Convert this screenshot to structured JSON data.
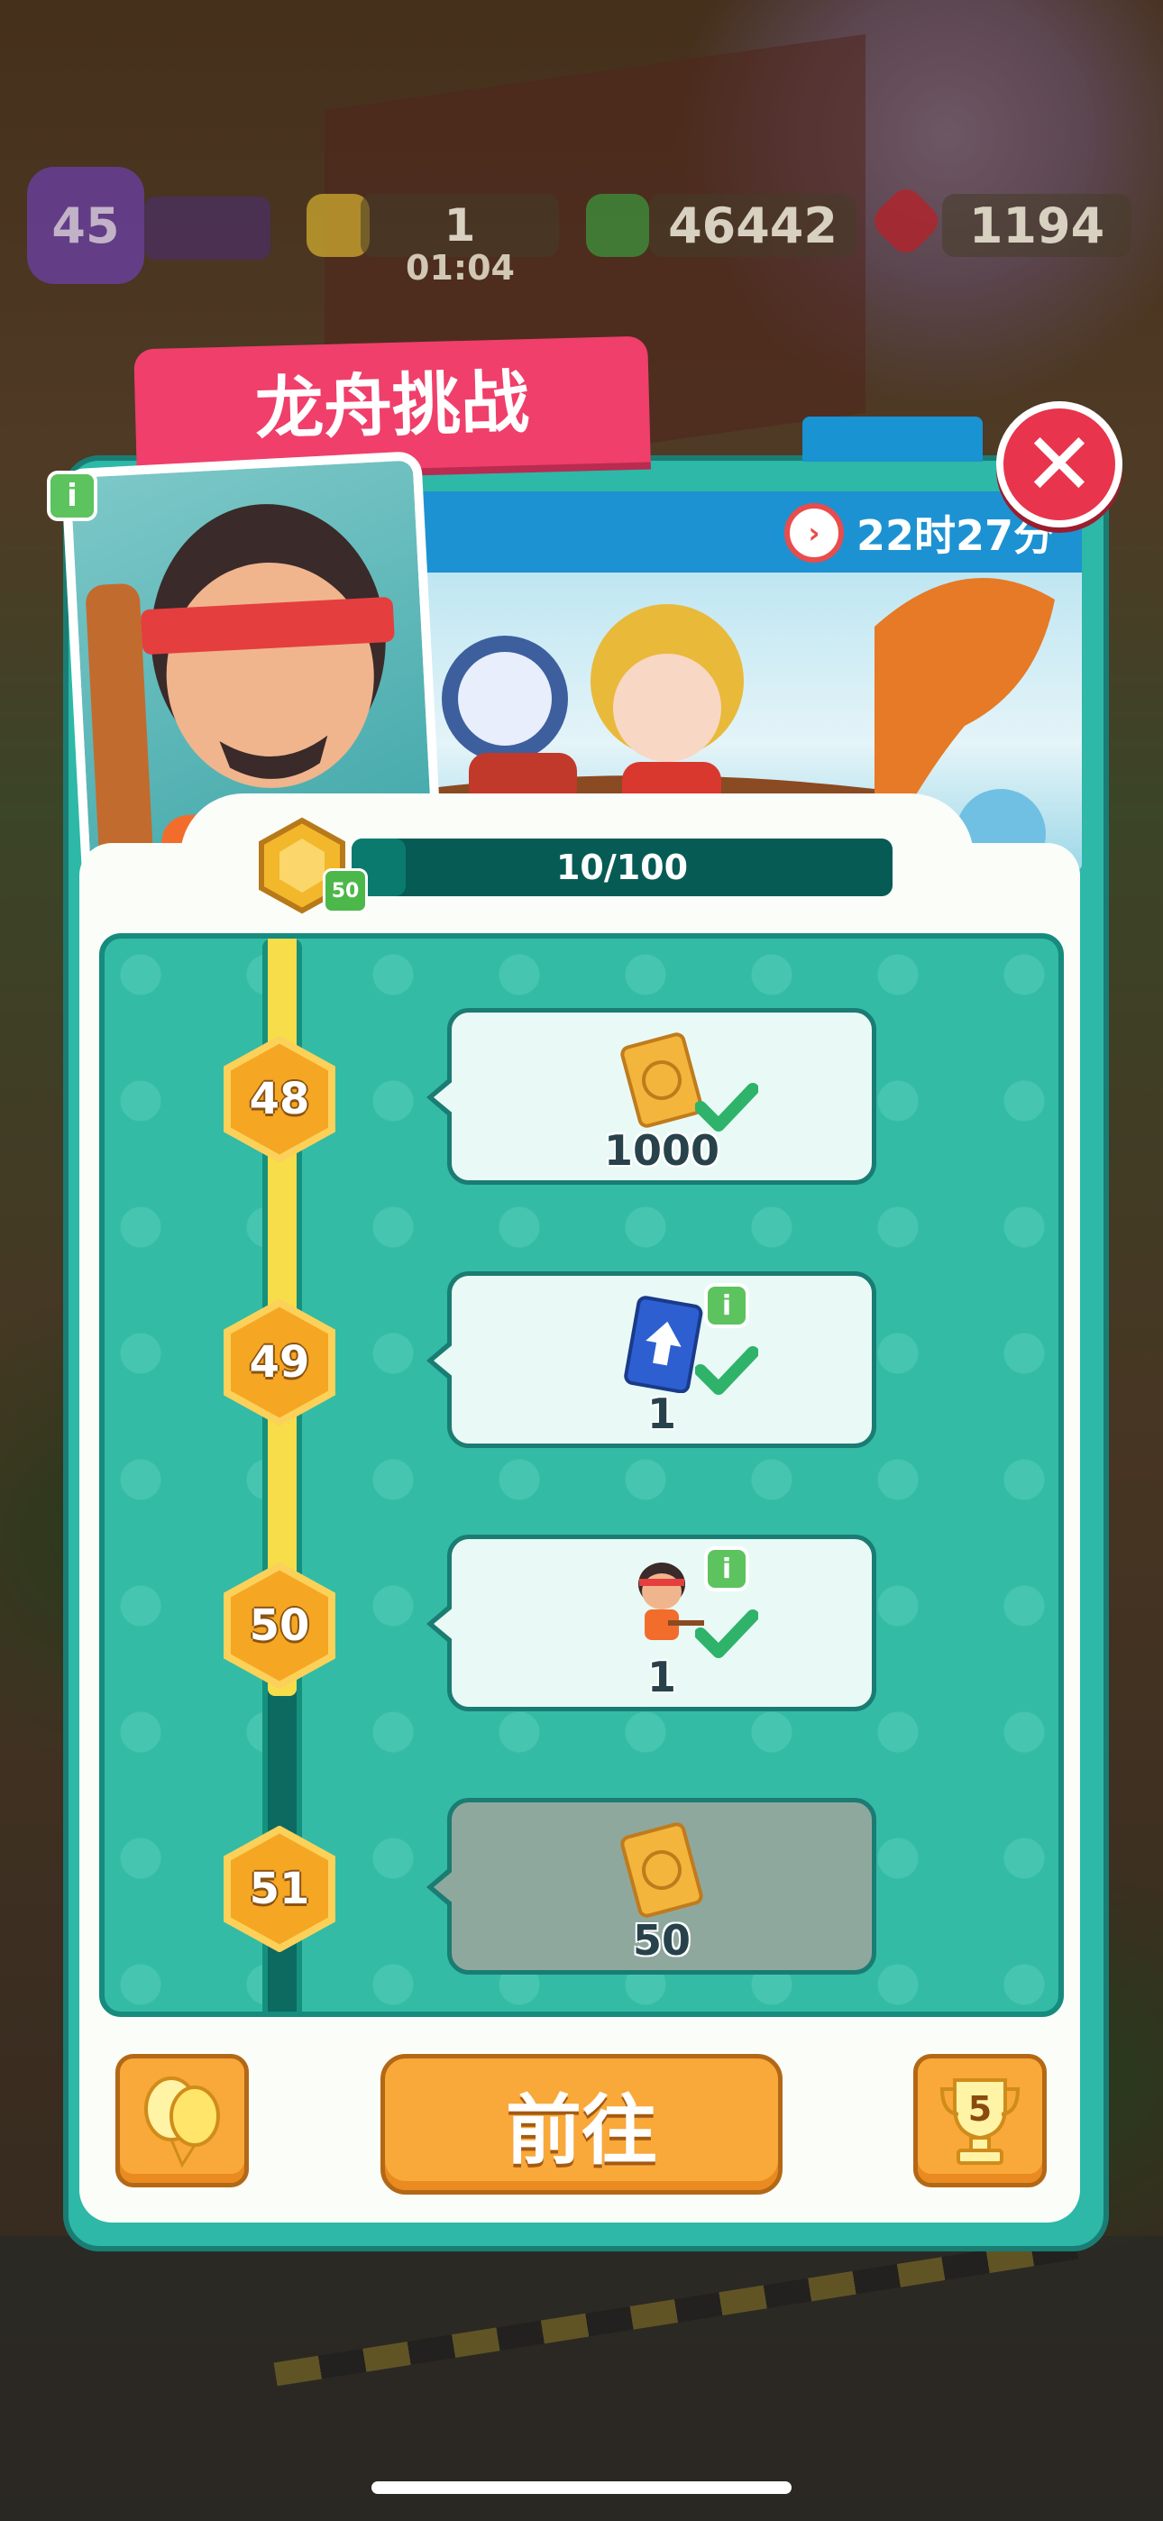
{
  "hud": {
    "player_level": "45",
    "energy": "1",
    "energy_timer": "01:04",
    "cash": "46442",
    "gems": "1194"
  },
  "event": {
    "title": "龙舟挑战",
    "timer": "22时27分",
    "token_badge": "50",
    "progress_text": "10/100",
    "progress_fraction": 0.1
  },
  "milestones": [
    {
      "level": "48",
      "reward_amount": "1000",
      "reward_icon": "ticket-icon",
      "claimed": true
    },
    {
      "level": "49",
      "reward_amount": "1",
      "reward_icon": "upgrade-card-icon",
      "claimed": true
    },
    {
      "level": "50",
      "reward_amount": "1",
      "reward_icon": "character-icon",
      "claimed": true
    },
    {
      "level": "51",
      "reward_amount": "50",
      "reward_icon": "ticket-icon",
      "claimed": false
    }
  ],
  "buttons": {
    "go_label": "前往",
    "trophy_rank": "5"
  },
  "colors": {
    "accent_pink": "#ef3f6a",
    "panel_teal": "#2db8a8",
    "button_orange": "#f9a83a",
    "close_red": "#e8344d"
  }
}
